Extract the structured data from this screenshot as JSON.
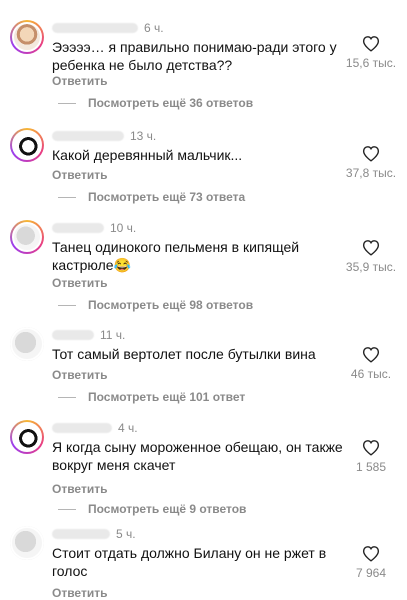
{
  "comments": [
    {
      "time": "6 ч.",
      "text": "Эээээ… я правильно понимаю-ради этого у ребенка не было детства??",
      "reply_label": "Ответить",
      "replies_label": "Посмотреть ещё 36 ответов",
      "likes": "15,6 тыс.",
      "icons": {
        "avatar": "avatar-face",
        "like": "heart-icon"
      }
    },
    {
      "time": "13 ч.",
      "text": "Какой деревянный мальчик...",
      "reply_label": "Ответить",
      "replies_label": "Посмотреть ещё 73 ответа",
      "likes": "37,8 тыс.",
      "icons": {
        "avatar": "avatar-dark",
        "like": "heart-icon"
      }
    },
    {
      "time": "10 ч.",
      "text": "Танец одинокого пельменя в кипящей кастрюле😂",
      "reply_label": "Ответить",
      "replies_label": "Посмотреть ещё 98 ответов",
      "likes": "35,9 тыс.",
      "icons": {
        "avatar": "avatar-gray",
        "like": "heart-icon"
      }
    },
    {
      "time": "11 ч.",
      "text": "Тот самый вертолет после бутылки вина",
      "reply_label": "Ответить",
      "replies_label": "Посмотреть ещё 101 ответ",
      "likes": "46 тыс.",
      "icons": {
        "avatar": "avatar-gray",
        "like": "heart-icon"
      }
    },
    {
      "time": "4 ч.",
      "text": "Я когда сыну мороженное обещаю, он также вокруг меня скачет",
      "reply_label": "Ответить",
      "replies_label": "Посмотреть ещё 9 ответов",
      "likes": "1 585",
      "icons": {
        "avatar": "avatar-dark",
        "like": "heart-icon"
      }
    },
    {
      "time": "5 ч.",
      "text": "Стоит отдать должно Билану он не ржет в голос",
      "reply_label": "Ответить",
      "likes": "7 964",
      "icons": {
        "avatar": "avatar-gray",
        "like": "heart-icon"
      }
    }
  ]
}
